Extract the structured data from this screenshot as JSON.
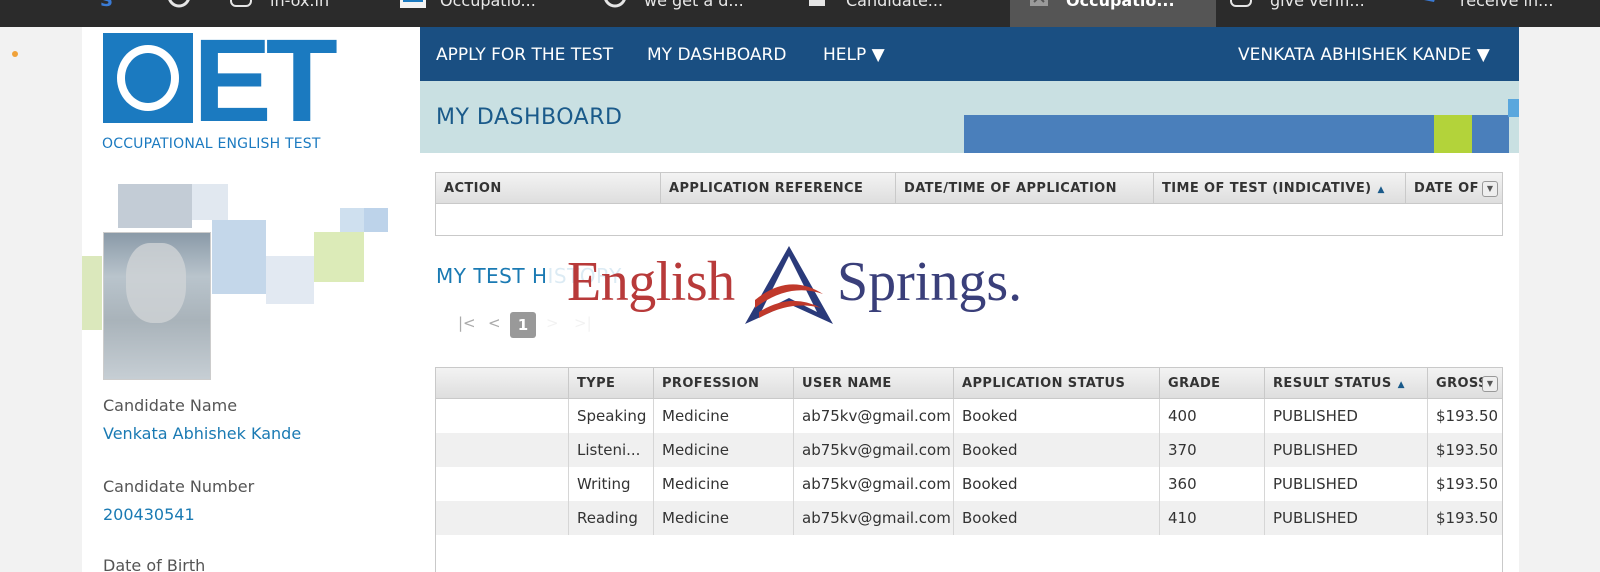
{
  "browser_tabs": [
    {
      "icon": "s-app-icon",
      "label": "",
      "active": false
    },
    {
      "icon": "google-icon",
      "label": "",
      "active": false
    },
    {
      "icon": "instagram-icon",
      "label": "in-ox.in",
      "active": false
    },
    {
      "icon": "oet-favicon-icon",
      "label": "Occupatio...",
      "active": false
    },
    {
      "icon": "google-icon",
      "label": "we get a d...",
      "active": false
    },
    {
      "icon": "document-icon",
      "label": "Candidate...",
      "active": false
    },
    {
      "icon": "close-tab-icon",
      "label": "Occupatio...",
      "active": true
    },
    {
      "icon": "instagram-icon",
      "label": "give verifi...",
      "active": false
    },
    {
      "icon": "arrow-icon",
      "label": "receive in...",
      "active": false
    }
  ],
  "logo": {
    "letters": "OET",
    "subtitle": "OCCUPATIONAL ENGLISH TEST"
  },
  "nav": {
    "apply": "APPLY FOR THE TEST",
    "dashboard": "MY DASHBOARD",
    "help": "HELP ▼",
    "user": "VENKATA ABHISHEK KANDE ▼"
  },
  "banner": {
    "title": "MY DASHBOARD"
  },
  "candidate": {
    "name_label": "Candidate Name",
    "name": "Venkata Abhishek Kande",
    "number_label": "Candidate Number",
    "number": "200430541",
    "dob_label": "Date of Birth"
  },
  "applications_table": {
    "headers": [
      "ACTION",
      "APPLICATION REFERENCE",
      "DATE/TIME OF APPLICATION",
      "TIME OF TEST (INDICATIVE)",
      "DATE OF"
    ],
    "rows": []
  },
  "test_history": {
    "title": "MY TEST HISTORY",
    "pager": {
      "first": "|<",
      "prev": "<",
      "page": "1",
      "next": ">",
      "last": ">|"
    },
    "headers": [
      "",
      "TYPE",
      "PROFESSION",
      "USER NAME",
      "APPLICATION STATUS",
      "GRADE",
      "RESULT STATUS",
      "GROSS"
    ],
    "rows": [
      {
        "type": "Speaking",
        "profession": "Medicine",
        "user": "ab75kv@gmail.com",
        "status": "Booked",
        "grade": "400",
        "result": "PUBLISHED",
        "gross": "$193.50"
      },
      {
        "type": "Listeni...",
        "profession": "Medicine",
        "user": "ab75kv@gmail.com",
        "status": "Booked",
        "grade": "370",
        "result": "PUBLISHED",
        "gross": "$193.50"
      },
      {
        "type": "Writing",
        "profession": "Medicine",
        "user": "ab75kv@gmail.com",
        "status": "Booked",
        "grade": "360",
        "result": "PUBLISHED",
        "gross": "$193.50"
      },
      {
        "type": "Reading",
        "profession": "Medicine",
        "user": "ab75kv@gmail.com",
        "status": "Booked",
        "grade": "410",
        "result": "PUBLISHED",
        "gross": "$193.50"
      }
    ]
  },
  "watermark": {
    "left": "English",
    "right": "Springs."
  },
  "colors": {
    "brand": "#1b7ac0",
    "nav": "#1a4f82",
    "banner": "#c9e0e2",
    "accent_green": "#b3d33a"
  }
}
